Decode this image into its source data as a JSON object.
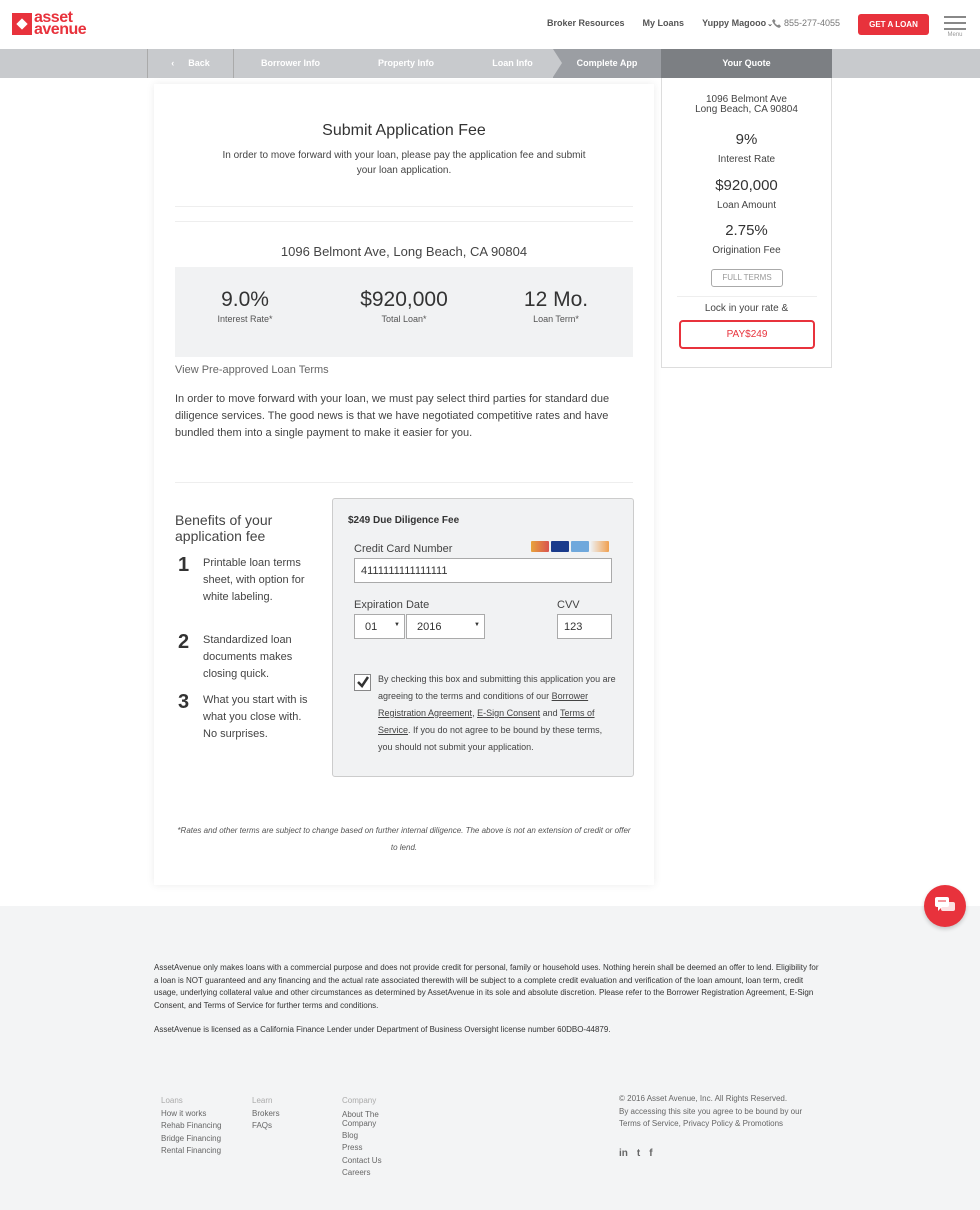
{
  "header": {
    "logo_text_1": "asset",
    "logo_text_2": "avenue",
    "nav": [
      "Broker Resources",
      "My Loans",
      "Yuppy Magooo"
    ],
    "phone": "855-277-4055",
    "cta": "GET A LOAN",
    "menu_label": "Menu"
  },
  "steps": {
    "back": "Back",
    "items": [
      "Borrower Info",
      "Property Info",
      "Loan Info",
      "Complete App"
    ],
    "your_quote": "Your Quote"
  },
  "card": {
    "title": "Submit Application Fee",
    "subtitle": "In order to move forward with your loan, please pay the application fee and submit your loan application.",
    "address": "1096 Belmont Ave, Long Beach, CA 90804",
    "stats": [
      {
        "value": "9.0%",
        "label": "Interest Rate*"
      },
      {
        "value": "$920,000",
        "label": "Total Loan*"
      },
      {
        "value": "12 Mo.",
        "label": "Loan Term*"
      }
    ],
    "view_terms": "View Pre-approved Loan Terms",
    "paragraph": "In order to move forward with your loan, we must pay select third parties for standard due diligence services. The good news is that we have negotiated competitive rates and have bundled them into a single payment to make it easier for you.",
    "benefits_title": "Benefits of your application fee",
    "benefits": [
      {
        "num": "1",
        "text": "Printable loan terms sheet, with option for white labeling."
      },
      {
        "num": "2",
        "text": "Standardized loan documents makes closing quick."
      },
      {
        "num": "3",
        "text": "What you start with is what you close with. No surprises."
      }
    ],
    "payment": {
      "title": "$249 Due Diligence Fee",
      "cc_label": "Credit Card Number",
      "cc_value": "4111111111111111",
      "exp_label": "Expiration Date",
      "exp_month": "01",
      "exp_year": "2016",
      "cvv_label": "CVV",
      "cvv_value": "123",
      "agree_1": "By checking this box and submitting this application you are agreeing to the terms and conditions of our",
      "link_bra": "Borrower Registration Agreement",
      "link_esign": "E-Sign Consent",
      "and": "and",
      "link_tos": "Terms of Service",
      "agree_2": ". If you do not agree to be bound by these terms, you should not submit your application."
    },
    "disclaimer": "*Rates and other terms are subject to change based on further internal diligence. The above is not an extension of credit or offer to lend."
  },
  "quote": {
    "address_1": "1096 Belmont Ave",
    "address_2": "Long Beach, CA 90804",
    "items": [
      {
        "value": "9%",
        "label": "Interest Rate"
      },
      {
        "value": "$920,000",
        "label": "Loan Amount"
      },
      {
        "value": "2.75%",
        "label": "Origination Fee"
      }
    ],
    "full_terms": "FULL TERMS",
    "lock": "Lock in your rate &",
    "pay": "PAY$249"
  },
  "footer": {
    "legal": "AssetAvenue only makes loans with a commercial purpose and does not provide credit for personal, family or household uses. Nothing herein shall be deemed an offer to lend. Eligibility for a loan is NOT guaranteed and any financing and the actual rate associated therewith will be subject to a complete credit evaluation and verification of the loan amount, loan term, credit usage, underlying collateral value and other circumstances as determined by AssetAvenue in its sole and absolute discretion. Please refer to the Borrower Registration Agreement, E-Sign Consent, and Terms of Service for further terms and conditions.",
    "license": "AssetAvenue is licensed as a California Finance Lender under Department of Business Oversight license number 60DBO-44879.",
    "cols": [
      {
        "head": "Loans",
        "links": [
          "How it works",
          "Rehab Financing",
          "Bridge Financing",
          "Rental Financing"
        ]
      },
      {
        "head": "Learn",
        "links": [
          "Brokers",
          "FAQs"
        ]
      },
      {
        "head": "Company",
        "links": [
          "About The Company",
          "Blog",
          "Press",
          "Contact Us",
          "Careers"
        ]
      }
    ],
    "copyright": "© 2016 Asset Avenue, Inc. All Rights Reserved.",
    "agree": "By accessing this site you agree to be bound by our",
    "tos": "Terms of Service",
    "privacy": ", Privacy Policy & Promotions",
    "social": [
      "in",
      "t",
      "f"
    ]
  },
  "colors": {
    "brand": "#e8323c"
  }
}
